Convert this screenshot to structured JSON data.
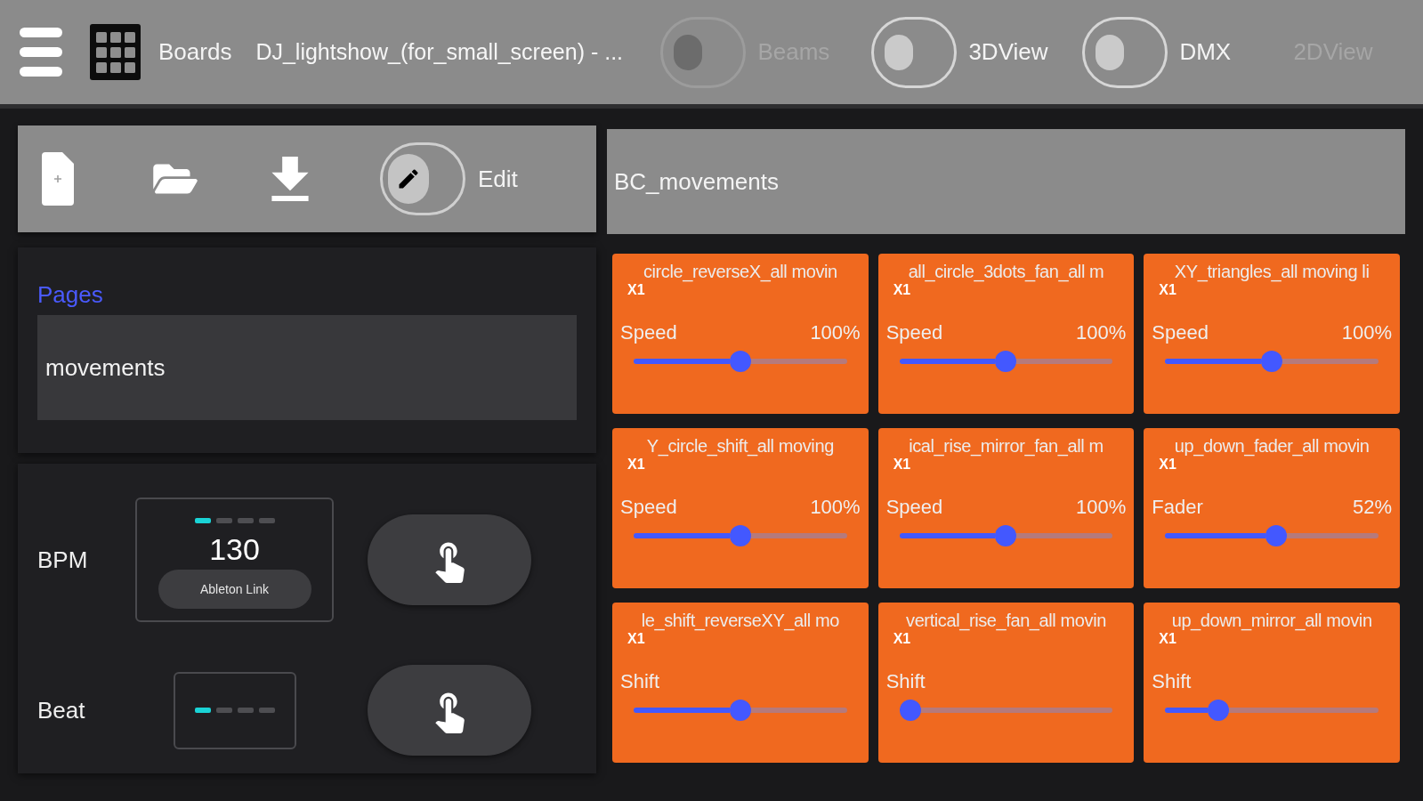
{
  "top_bar": {
    "boards_label": "Boards",
    "title": "DJ_lightshow_(for_small_screen) - ...",
    "toggles": [
      {
        "label": "Beams",
        "on": false,
        "disabled": true
      },
      {
        "label": "3DView",
        "on": false,
        "disabled": false
      },
      {
        "label": "DMX",
        "on": false,
        "disabled": false
      }
    ],
    "view_label": {
      "text": "2DView",
      "disabled": true
    }
  },
  "toolbar": {
    "edit_toggle": {
      "label": "Edit",
      "on": false
    }
  },
  "pages": {
    "title": "Pages",
    "items": [
      {
        "label": "movements",
        "selected": true
      }
    ]
  },
  "tempo": {
    "bpm": {
      "label": "BPM",
      "value": "130",
      "link_button": "Ableton Link",
      "beats": [
        {
          "on": true
        },
        {
          "on": false
        },
        {
          "on": false
        },
        {
          "on": false
        }
      ]
    },
    "beat": {
      "label": "Beat",
      "beats": [
        {
          "on": true
        },
        {
          "on": false
        },
        {
          "on": false
        },
        {
          "on": false
        }
      ]
    }
  },
  "board": {
    "title": "BC_movements",
    "cards": [
      {
        "title": "circle_reverseX_all movin",
        "badge": "X1",
        "control": "Speed",
        "value": "100%",
        "level": 0.5
      },
      {
        "title": "all_circle_3dots_fan_all m",
        "badge": "X1",
        "control": "Speed",
        "value": "100%",
        "level": 0.5
      },
      {
        "title": "XY_triangles_all moving li",
        "badge": "X1",
        "control": "Speed",
        "value": "100%",
        "level": 0.5
      },
      {
        "title": "Y_circle_shift_all moving",
        "badge": "X1",
        "control": "Speed",
        "value": "100%",
        "level": 0.5
      },
      {
        "title": "ical_rise_mirror_fan_all m",
        "badge": "X1",
        "control": "Speed",
        "value": "100%",
        "level": 0.5
      },
      {
        "title": "up_down_fader_all movin",
        "badge": "X1",
        "control": "Fader",
        "value": "52%",
        "level": 0.52
      },
      {
        "title": "le_shift_reverseXY_all mo",
        "badge": "X1",
        "control": "Shift",
        "level": 0.5
      },
      {
        "title": "vertical_rise_fan_all movin",
        "badge": "X1",
        "control": "Shift",
        "level": 0
      },
      {
        "title": "up_down_mirror_all movin",
        "badge": "X1",
        "control": "Shift",
        "level": 0.25
      }
    ]
  }
}
